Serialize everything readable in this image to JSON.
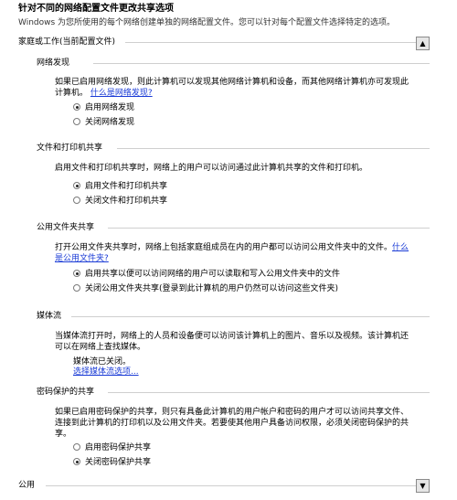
{
  "header": {
    "title": "针对不同的网络配置文件更改共享选项",
    "subtitle": "Windows 为您所使用的每个网络创建单独的网络配置文件。您可以针对每个配置文件选择特定的选项。"
  },
  "profile": {
    "label": "家庭或工作(当前配置文件)",
    "collapse_glyph": "▲"
  },
  "sections": {
    "network_discovery": {
      "title": "网络发现",
      "desc_line1": "如果已启用网络发现，则此计算机可以发现其他网络计算机和设备，而其他网络计算机亦可发现此",
      "desc_line2": "计算机。",
      "link": "什么是网络发现?",
      "opt_on": "启用网络发现",
      "opt_off": "关闭网络发现"
    },
    "file_printer": {
      "title": "文件和打印机共享",
      "desc": "启用文件和打印机共享时，网络上的用户可以访问通过此计算机共享的文件和打印机。",
      "opt_on": "启用文件和打印机共享",
      "opt_off": "关闭文件和打印机共享"
    },
    "public_folder": {
      "title": "公用文件夹共享",
      "desc_line1": "打开公用文件夹共享时，网络上包括家庭组成员在内的用户都可以访问公用文件夹中的文件。",
      "link1": "什么",
      "link2": "是公用文件夹?",
      "opt_on": "启用共享以便可以访问网络的用户可以读取和写入公用文件夹中的文件",
      "opt_off": "关闭公用文件夹共享(登录到此计算机的用户仍然可以访问这些文件夹)"
    },
    "media_streaming": {
      "title": "媒体流",
      "desc_line1": "当媒体流打开时，网络上的人员和设备便可以访问该计算机上的图片、音乐以及视频。该计算机还",
      "desc_line2": "可以在网络上查找媒体。",
      "status": "媒体流已关闭。",
      "link": "选择媒体流选项..."
    },
    "password_sharing": {
      "title": "密码保护的共享",
      "desc_line1": "如果已启用密码保护的共享，则只有具备此计算机的用户帐户和密码的用户才可以访问共享文件、",
      "desc_line2": "连接到此计算机的打印机以及公用文件夹。若要使其他用户具备访问权限，必须关闭密码保护的共",
      "desc_line3": "享。",
      "opt_on": "启用密码保护共享",
      "opt_off": "关闭密码保护共享"
    }
  },
  "public_profile": {
    "label": "公用",
    "expand_glyph": "▼"
  }
}
